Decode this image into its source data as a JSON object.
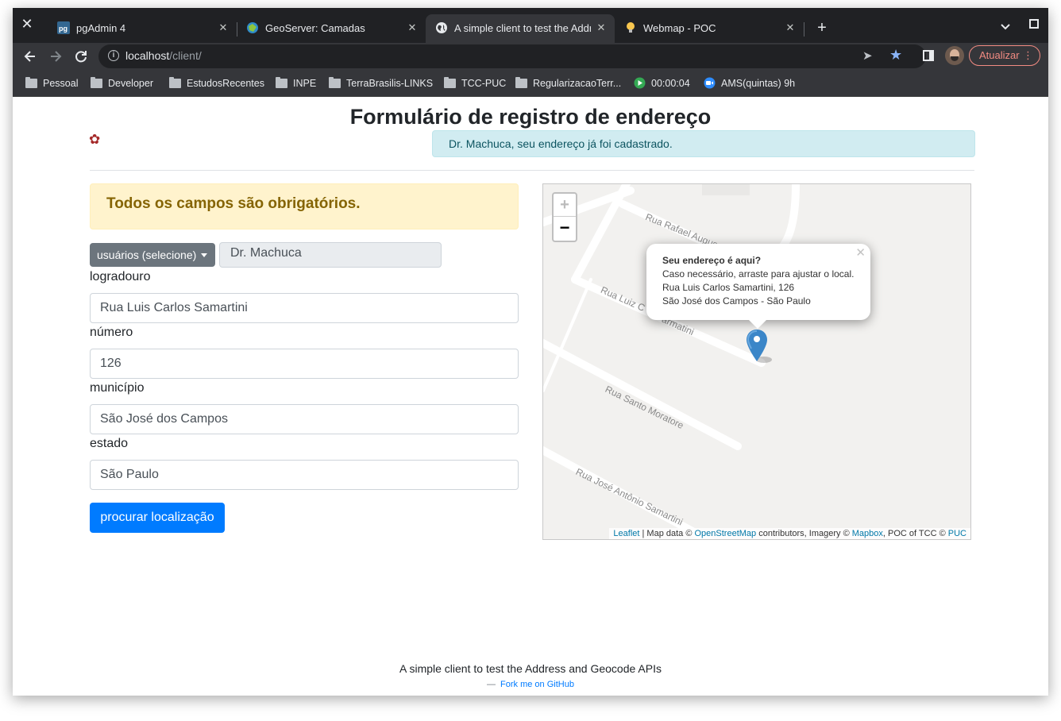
{
  "browser": {
    "tabs": [
      {
        "title": "pgAdmin 4",
        "icon": "pgadmin-icon"
      },
      {
        "title": "GeoServer: Camadas",
        "icon": "geoserver-icon"
      },
      {
        "title": "A simple client to test the Address and Geocode APIs",
        "icon": "globe-icon",
        "active": true
      },
      {
        "title": "Webmap - POC",
        "icon": "bulb-icon"
      }
    ],
    "url_host": "localhost",
    "url_path": "/client/",
    "update_label": "Atualizar",
    "bookmarks": [
      "Pessoal",
      "Developer",
      "EstudosRecentes",
      "INPE",
      "TerraBrasilis-LINKS",
      "TCC-PUC",
      "RegularizacaoTerr...",
      "00:00:04",
      "AMS(quintas) 9h"
    ]
  },
  "page": {
    "title": "Formulário de registro de endereço",
    "info_alert": "Dr. Machuca, seu endereço já foi cadastrado.",
    "warning_alert": "Todos os campos são obrigatórios.",
    "user_select_label": "usuários (selecione)",
    "user_value": "Dr. Machuca",
    "fields": {
      "logradouro": {
        "label": "logradouro",
        "value": "Rua Luis Carlos Samartini"
      },
      "numero": {
        "label": "número",
        "value": "126"
      },
      "municipio": {
        "label": "município",
        "value": "São José dos Campos"
      },
      "estado": {
        "label": "estado",
        "value": "São Paulo"
      }
    },
    "search_button": "procurar localização"
  },
  "map": {
    "zoom_in": "+",
    "zoom_out": "−",
    "streets": [
      "Rua Rafael Augus",
      "Rua Luiz C",
      "armatini",
      "Rua Santo Moratore",
      "Rua José Antônio Samartini"
    ],
    "popup": {
      "title": "Seu endereço é aqui?",
      "line1": "Caso necessário, arraste para ajustar o local.",
      "line2": "Rua Luis Carlos Samartini, 126",
      "line3": "São José dos Campos - São Paulo"
    },
    "attribution": {
      "leaflet": "Leaflet",
      "sep1": " | Map data © ",
      "osm": "OpenStreetMap",
      "mid": " contributors, Imagery © ",
      "mapbox": "Mapbox",
      "tail": ", POC of TCC © ",
      "puc": "PUC"
    },
    "colors": {
      "marker": "#3b86c8",
      "road": "#ffffff",
      "background": "#f2f1ef"
    }
  },
  "footer": {
    "text": "A simple client to test the Address and Geocode APIs",
    "dash": "—",
    "link": "Fork me on GitHub"
  }
}
